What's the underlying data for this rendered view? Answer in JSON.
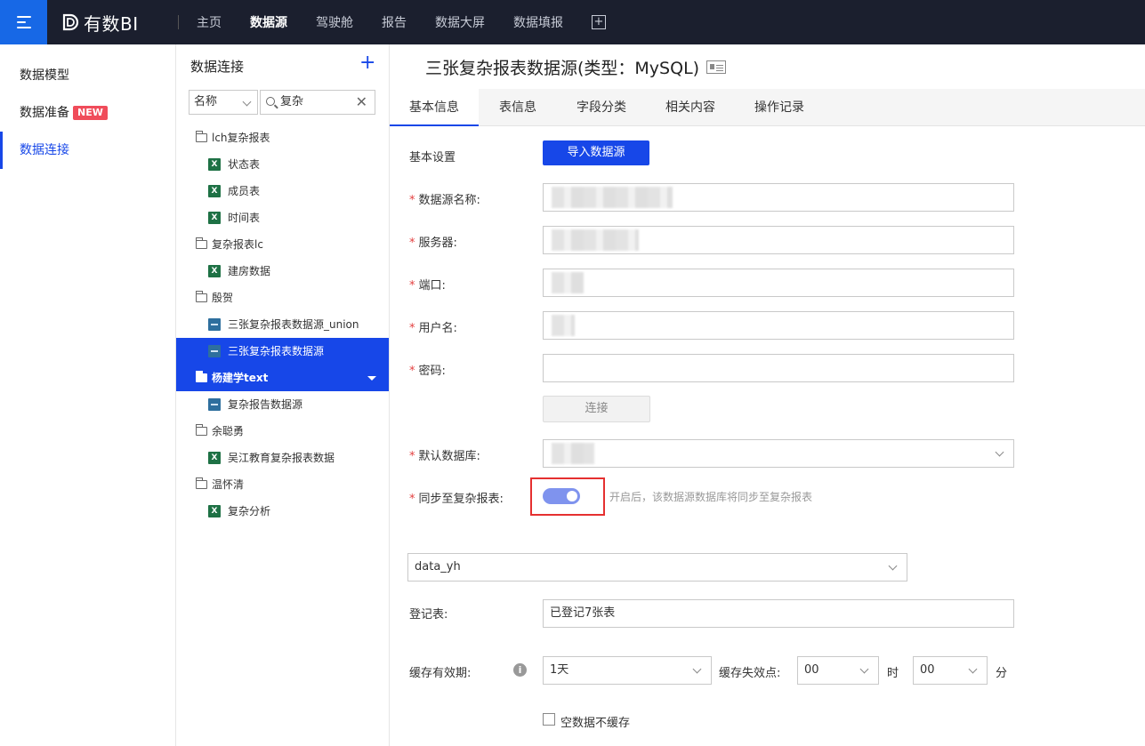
{
  "topbar": {
    "logo_text": "有数BI",
    "nav": [
      "主页",
      "数据源",
      "驾驶舱",
      "报告",
      "数据大屏",
      "数据填报"
    ],
    "active_nav": "数据源"
  },
  "leftnav": {
    "items": [
      "数据模型",
      "数据准备",
      "数据连接"
    ],
    "new_badge": "NEW",
    "active": "数据连接"
  },
  "tree": {
    "title": "数据连接",
    "filter_select": "名称",
    "search_value": "复杂",
    "rows": [
      {
        "type": "folder",
        "label": "lch复杂报表"
      },
      {
        "type": "excel",
        "label": "状态表"
      },
      {
        "type": "excel",
        "label": "成员表"
      },
      {
        "type": "excel",
        "label": "时间表"
      },
      {
        "type": "folder",
        "label": "复杂报表lc"
      },
      {
        "type": "excel",
        "label": "建房数据"
      },
      {
        "type": "folder",
        "label": "殷贺"
      },
      {
        "type": "mysql",
        "label": "三张复杂报表数据源_union"
      },
      {
        "type": "mysql",
        "label": "三张复杂报表数据源"
      },
      {
        "type": "folder",
        "label": "杨建学text"
      },
      {
        "type": "mysql",
        "label": "复杂报告数据源"
      },
      {
        "type": "folder",
        "label": "余聪勇"
      },
      {
        "type": "excel",
        "label": "吴江教育复杂报表数据"
      },
      {
        "type": "folder",
        "label": "温怀清"
      },
      {
        "type": "excel",
        "label": "复杂分析"
      }
    ]
  },
  "main": {
    "title": "三张复杂报表数据源(类型：MySQL)",
    "tabs": [
      "基本信息",
      "表信息",
      "字段分类",
      "相关内容",
      "操作记录"
    ],
    "active_tab": "基本信息",
    "form": {
      "basic_settings_label": "基本设置",
      "import_button": "导入数据源",
      "datasource_name_label": "数据源名称:",
      "server_label": "服务器:",
      "port_label": "端口:",
      "username_label": "用户名:",
      "password_label": "密码:",
      "connect_button": "连接",
      "default_db_label": "默认数据库:",
      "sync_label": "同步至复杂报表:",
      "sync_hint": "开启后，该数据源数据库将同步至复杂报表",
      "sync_enabled": true,
      "schema_select": "data_yh",
      "register_label": "登记表:",
      "register_value": "已登记7张表",
      "cache_label": "缓存有效期:",
      "cache_value": "1天",
      "cache_expire_label": "缓存失效点:",
      "hour_value": "00",
      "hour_unit": "时",
      "minute_value": "00",
      "minute_unit": "分",
      "empty_cache_label": "空数据不缓存"
    }
  }
}
